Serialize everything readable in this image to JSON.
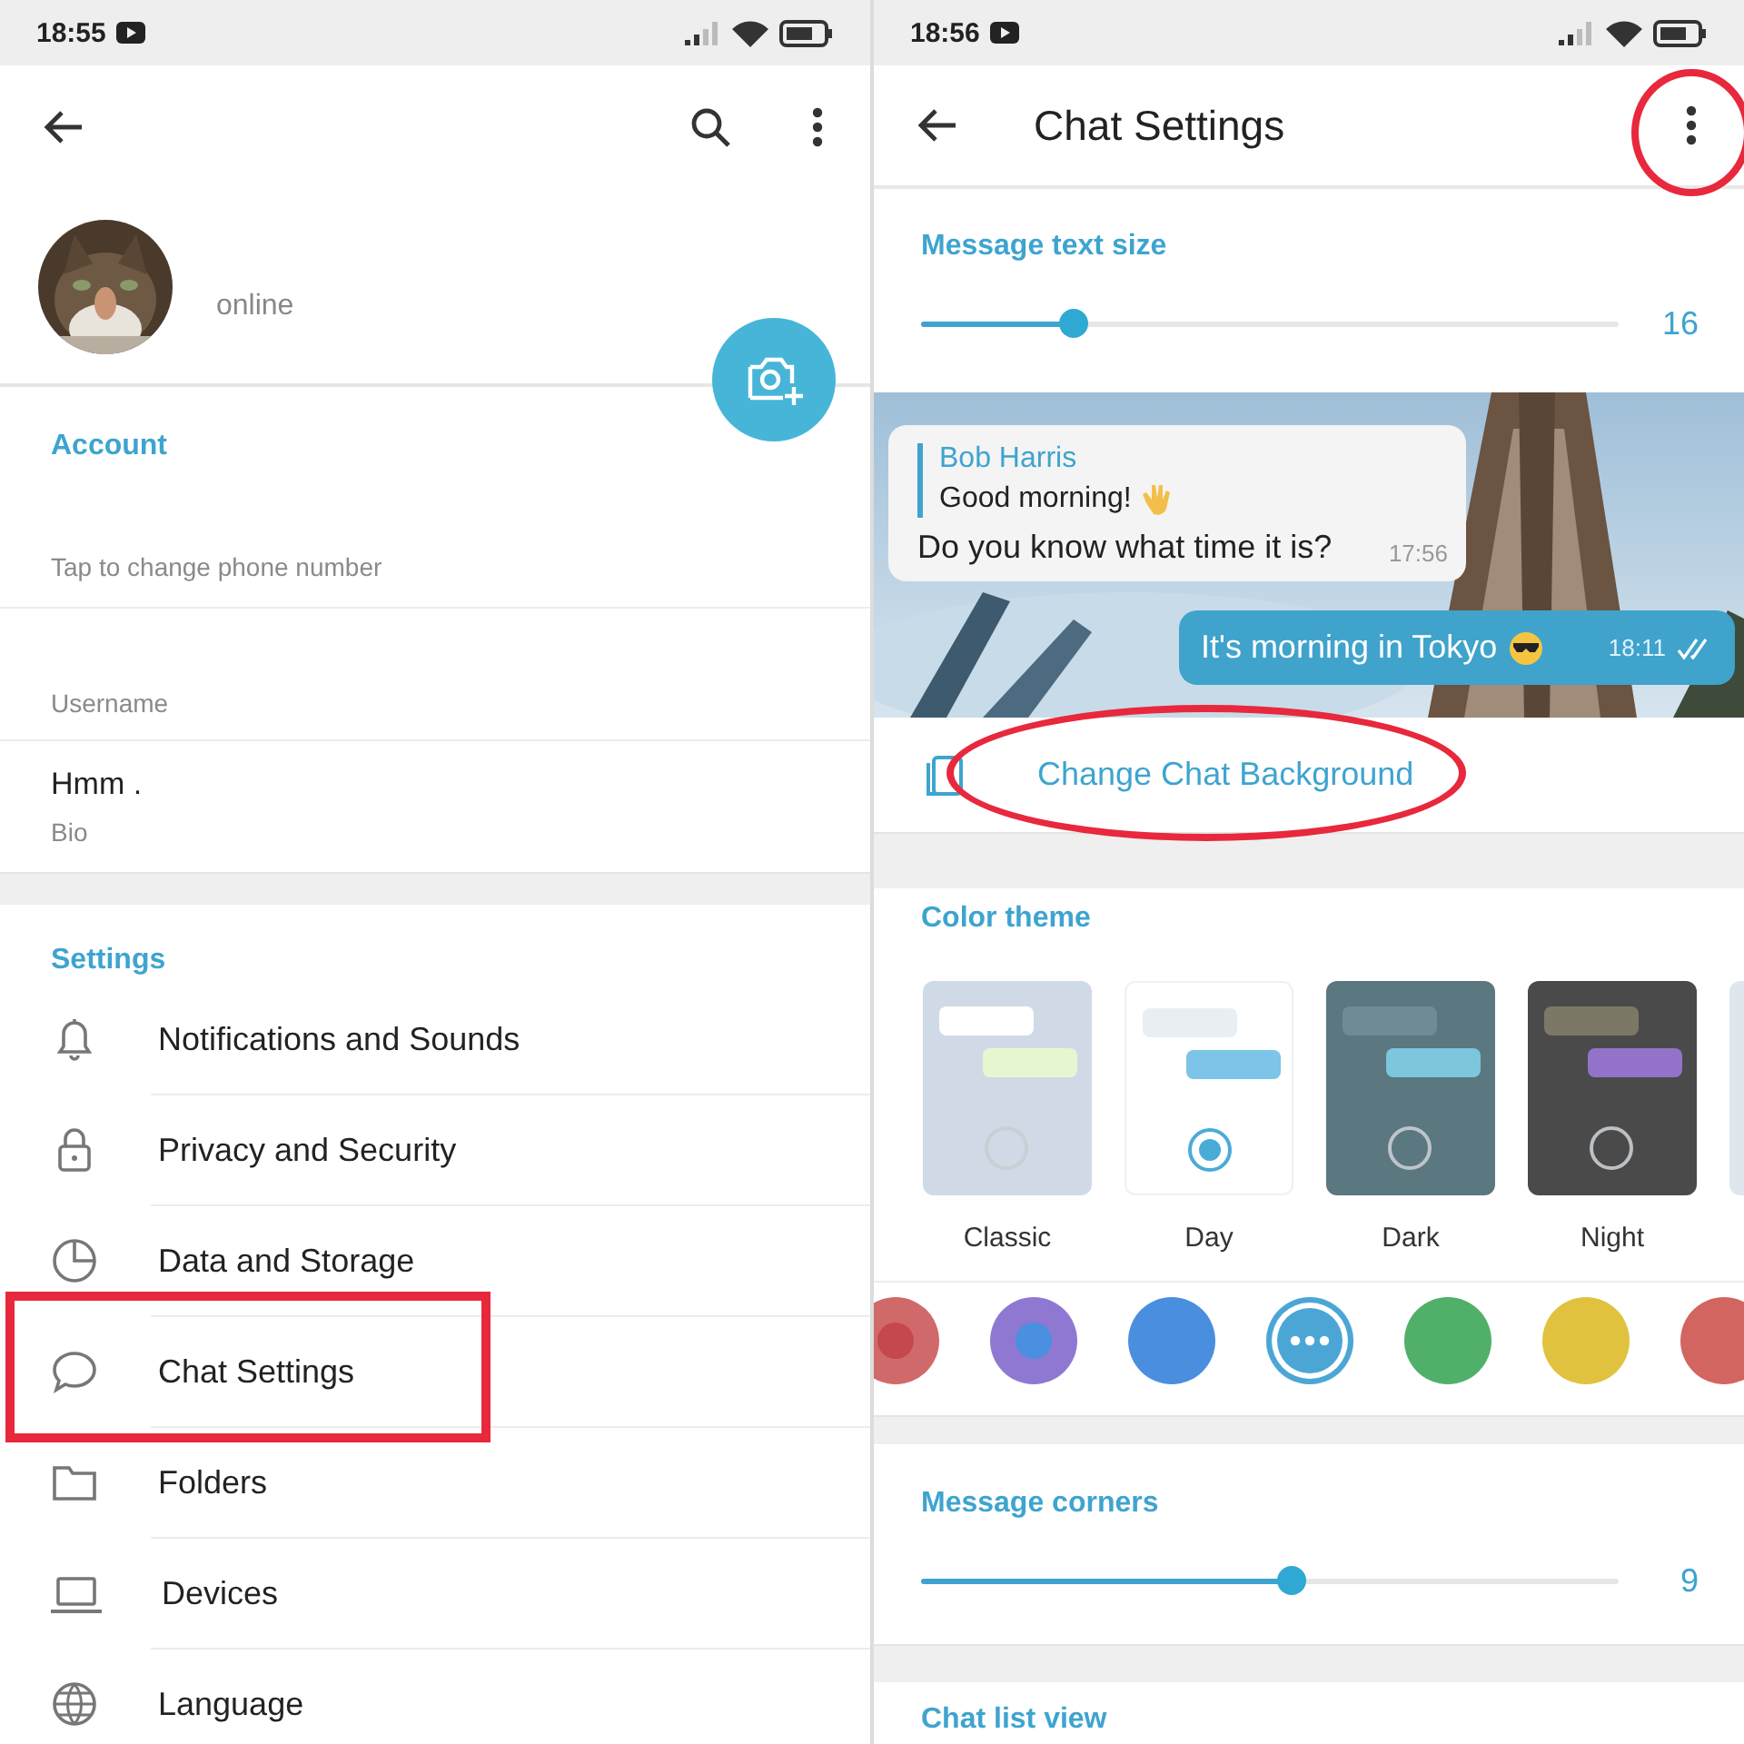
{
  "profile_screen": {
    "status_bar": {
      "time": "18:55"
    },
    "profile": {
      "status": "online"
    },
    "account": {
      "header": "Account",
      "phone_hint": "Tap to change phone number",
      "username_label": "Username",
      "bio_value": "Hmm .",
      "bio_label": "Bio"
    },
    "settings": {
      "header": "Settings",
      "items": [
        {
          "kind": "bell",
          "label": "Notifications and Sounds",
          "highlighted": false
        },
        {
          "kind": "lock",
          "label": "Privacy and Security",
          "highlighted": false
        },
        {
          "kind": "pie",
          "label": "Data and Storage",
          "highlighted": false
        },
        {
          "kind": "chat",
          "label": "Chat Settings",
          "highlighted": true
        },
        {
          "kind": "folder",
          "label": "Folders",
          "highlighted": false
        },
        {
          "kind": "laptop",
          "label": "Devices",
          "highlighted": false
        },
        {
          "kind": "globe",
          "label": "Language",
          "highlighted": false
        }
      ]
    }
  },
  "chat_settings_screen": {
    "status_bar": {
      "time": "18:56"
    },
    "toolbar": {
      "title": "Chat Settings",
      "menu_highlighted": true
    },
    "text_size": {
      "header": "Message text size",
      "level": 0.22,
      "reading": "16"
    },
    "preview": {
      "incoming": {
        "reply_name": "Bob Harris",
        "reply_text": "Good morning!",
        "text": "Do you know what time it is?",
        "time": "17:56"
      },
      "outgoing": {
        "text": "It's morning in Tokyo",
        "time": "18:11",
        "read": true
      }
    },
    "background_button": {
      "label": "Change Chat Background",
      "highlighted": true
    },
    "color_theme": {
      "header": "Color theme",
      "themes": [
        {
          "name": "Classic",
          "selected": false,
          "color": "#cfdae6",
          "incoming": {
            "color": "#ffffff"
          },
          "outgoing": {
            "color": "#e6f7cf"
          }
        },
        {
          "name": "Day",
          "selected": true,
          "color": "#ffffff",
          "incoming": {
            "color": "#e8eef2"
          },
          "outgoing": {
            "color": "#7cc4e8"
          }
        },
        {
          "name": "Dark",
          "selected": false,
          "color": "#5b7780",
          "incoming": {
            "color": "#6f8c94"
          },
          "outgoing": {
            "color": "#7cc6de"
          }
        },
        {
          "name": "Night",
          "selected": false,
          "color": "#4a4a4a",
          "incoming": {
            "color": "#7b7966"
          },
          "outgoing": {
            "color": "#9273c9"
          }
        },
        {
          "color": "#dfe6ee"
        }
      ],
      "accents": [
        {
          "color": "#d06a6a",
          "inner_dot": {
            "color": "#c4484d"
          },
          "selected": false
        },
        {
          "color": "#8f78d2",
          "inner_dot": {
            "color": "#4a8fe0"
          },
          "selected": false
        },
        {
          "color": "#4a8ee0",
          "selected": false
        },
        {
          "color": "#4ba6d6",
          "selected": true
        },
        {
          "color": "#50b06a",
          "selected": false
        },
        {
          "color": "#e0c23e",
          "selected": false
        },
        {
          "color": "#d26560",
          "selected": false
        }
      ]
    },
    "corners": {
      "header": "Message corners",
      "level": 0.53,
      "reading": "9"
    },
    "chat_list": {
      "header": "Chat list view"
    }
  }
}
